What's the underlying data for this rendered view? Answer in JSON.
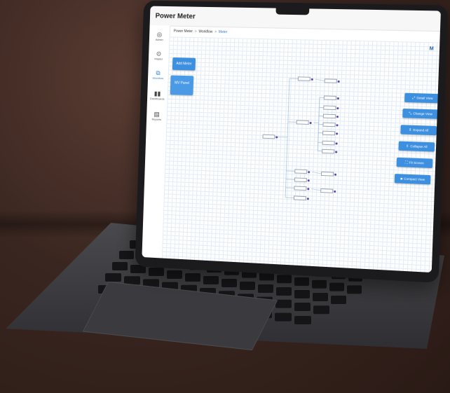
{
  "app": {
    "title": "Power Meter"
  },
  "sidebar": {
    "items": [
      {
        "label": "Admin",
        "icon": "admin-icon"
      },
      {
        "label": "Master",
        "icon": "master-icon"
      },
      {
        "label": "Workflow",
        "icon": "workflow-icon",
        "active": true
      },
      {
        "label": "Dashboards",
        "icon": "dashboards-icon"
      },
      {
        "label": "Reports",
        "icon": "reports-icon"
      }
    ]
  },
  "breadcrumb": {
    "items": [
      "Power Meter",
      "Workflow",
      "Meter"
    ],
    "separator": ">"
  },
  "user": {
    "avatar_initial": "M"
  },
  "toolbar": {
    "add_meter": "Add Meter",
    "mv_panel": "MV Panel"
  },
  "view_controls": [
    {
      "label": "Detail View",
      "icon": "detail-view-icon"
    },
    {
      "label": "Change View",
      "icon": "change-view-icon"
    },
    {
      "label": "Expand All",
      "icon": "expand-icon"
    },
    {
      "label": "Collapse All",
      "icon": "collapse-icon"
    },
    {
      "label": "Fit Screen",
      "icon": "fit-screen-icon"
    },
    {
      "label": "Compact View",
      "icon": "compact-view-icon"
    }
  ],
  "colors": {
    "accent": "#3d8fe0",
    "node_dot": "#5b3fa8",
    "grid": "#e2ebf6"
  }
}
